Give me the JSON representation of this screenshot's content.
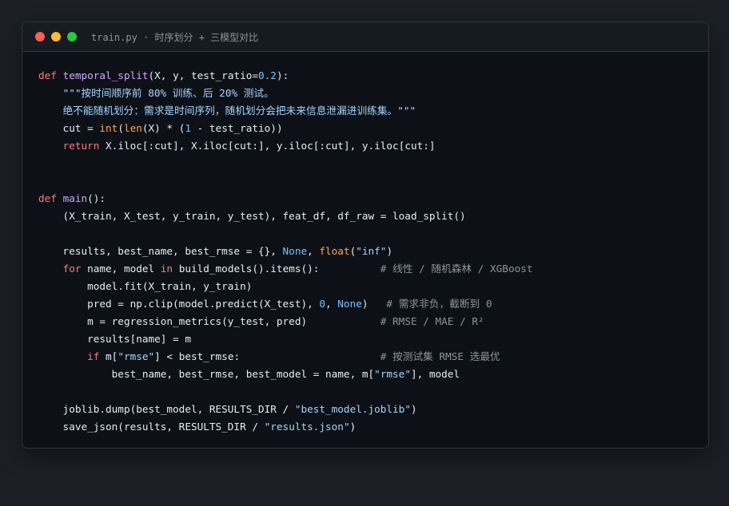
{
  "window": {
    "title": "train.py · 时序划分 + 三模型对比"
  },
  "code_lines": [
    [
      {
        "t": "def",
        "c": "kw"
      },
      {
        "t": " "
      },
      {
        "t": "temporal_split",
        "c": "fn"
      },
      {
        "t": "(X, y, test_ratio="
      },
      {
        "t": "0.2",
        "c": "num"
      },
      {
        "t": "):"
      }
    ],
    [
      {
        "t": "    "
      },
      {
        "t": "\"\"\"按时间顺序前 80% 训练、后 20% 测试。",
        "c": "str"
      }
    ],
    [
      {
        "t": "    "
      },
      {
        "t": "绝不能随机划分：需求是时间序列，随机划分会把未来信息泄漏进训练集。\"\"\"",
        "c": "str"
      }
    ],
    [
      {
        "t": "    cut = "
      },
      {
        "t": "int",
        "c": "bi"
      },
      {
        "t": "("
      },
      {
        "t": "len",
        "c": "bi"
      },
      {
        "t": "(X) * ("
      },
      {
        "t": "1",
        "c": "num"
      },
      {
        "t": " - test_ratio))"
      }
    ],
    [
      {
        "t": "    "
      },
      {
        "t": "return",
        "c": "kw"
      },
      {
        "t": " X.iloc[:cut], X.iloc[cut:], y.iloc[:cut], y.iloc[cut:]"
      }
    ],
    [],
    [],
    [
      {
        "t": "def",
        "c": "kw"
      },
      {
        "t": " "
      },
      {
        "t": "main",
        "c": "fn"
      },
      {
        "t": "():"
      }
    ],
    [
      {
        "t": "    (X_train, X_test, y_train, y_test), feat_df, df_raw = load_split()"
      }
    ],
    [],
    [
      {
        "t": "    results, best_name, best_rmse = {}, "
      },
      {
        "t": "None",
        "c": "num"
      },
      {
        "t": ", "
      },
      {
        "t": "float",
        "c": "bi"
      },
      {
        "t": "("
      },
      {
        "t": "\"inf\"",
        "c": "str"
      },
      {
        "t": ")"
      }
    ],
    [
      {
        "t": "    "
      },
      {
        "t": "for",
        "c": "kw"
      },
      {
        "t": " name, model "
      },
      {
        "t": "in",
        "c": "kw"
      },
      {
        "t": " build_models().items():          "
      },
      {
        "t": "# 线性 / 随机森林 / XGBoost",
        "c": "cmt"
      }
    ],
    [
      {
        "t": "        model.fit(X_train, y_train)"
      }
    ],
    [
      {
        "t": "        pred = np.clip(model.predict(X_test), "
      },
      {
        "t": "0",
        "c": "num"
      },
      {
        "t": ", "
      },
      {
        "t": "None",
        "c": "num"
      },
      {
        "t": ")   "
      },
      {
        "t": "# 需求非负，截断到 0",
        "c": "cmt"
      }
    ],
    [
      {
        "t": "        m = regression_metrics(y_test, pred)            "
      },
      {
        "t": "# RMSE / MAE / R²",
        "c": "cmt"
      }
    ],
    [
      {
        "t": "        results[name] = m"
      }
    ],
    [
      {
        "t": "        "
      },
      {
        "t": "if",
        "c": "kw"
      },
      {
        "t": " m["
      },
      {
        "t": "\"rmse\"",
        "c": "str"
      },
      {
        "t": "] < best_rmse:                       "
      },
      {
        "t": "# 按测试集 RMSE 选最优",
        "c": "cmt"
      }
    ],
    [
      {
        "t": "            best_name, best_rmse, best_model = name, m["
      },
      {
        "t": "\"rmse\"",
        "c": "str"
      },
      {
        "t": "], model"
      }
    ],
    [],
    [
      {
        "t": "    joblib.dump(best_model, RESULTS_DIR / "
      },
      {
        "t": "\"best_model.joblib\"",
        "c": "str"
      },
      {
        "t": ")"
      }
    ],
    [
      {
        "t": "    save_json(results, RESULTS_DIR / "
      },
      {
        "t": "\"results.json\"",
        "c": "str"
      },
      {
        "t": ")"
      }
    ]
  ]
}
